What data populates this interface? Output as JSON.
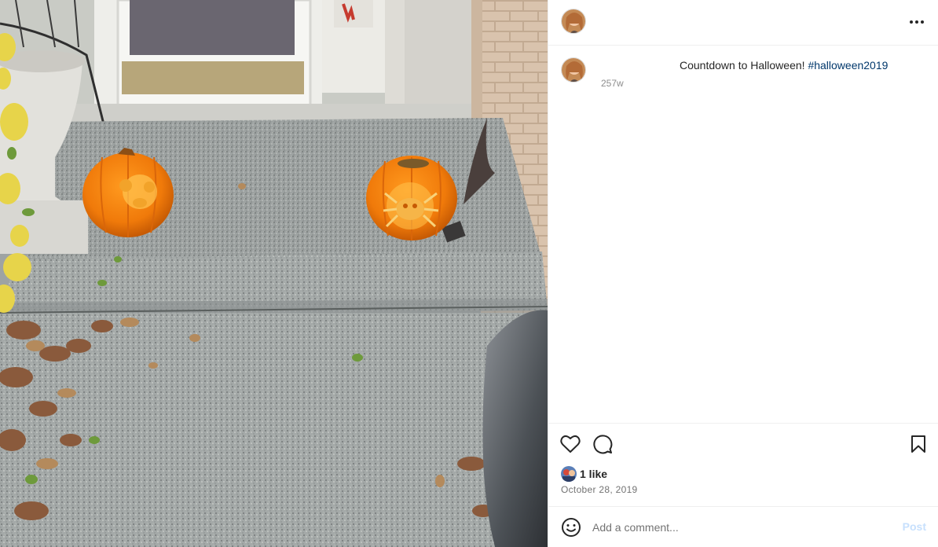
{
  "post": {
    "photo_alt": "Carved jack-o'-lanterns on a front porch step",
    "header": {
      "avatar_icon": "profile-avatar",
      "more_icon": "more-options-icon"
    },
    "caption": {
      "text": "Countdown to Halloween! ",
      "hashtag": "#halloween2019",
      "time": "257w"
    },
    "actions": {
      "like_icon": "heart-icon",
      "comment_icon": "comment-bubble-icon",
      "save_icon": "bookmark-icon"
    },
    "likes": {
      "count_label": "1 like"
    },
    "date": "October 28, 2019",
    "comment_box": {
      "placeholder": "Add a comment...",
      "post_label": "Post",
      "emoji_icon": "emoji-smiley-icon"
    },
    "colors": {
      "hashtag": "#00376b",
      "post_disabled": "#c7e0fd",
      "secondary_text": "#737373",
      "divider": "#efefef"
    }
  }
}
